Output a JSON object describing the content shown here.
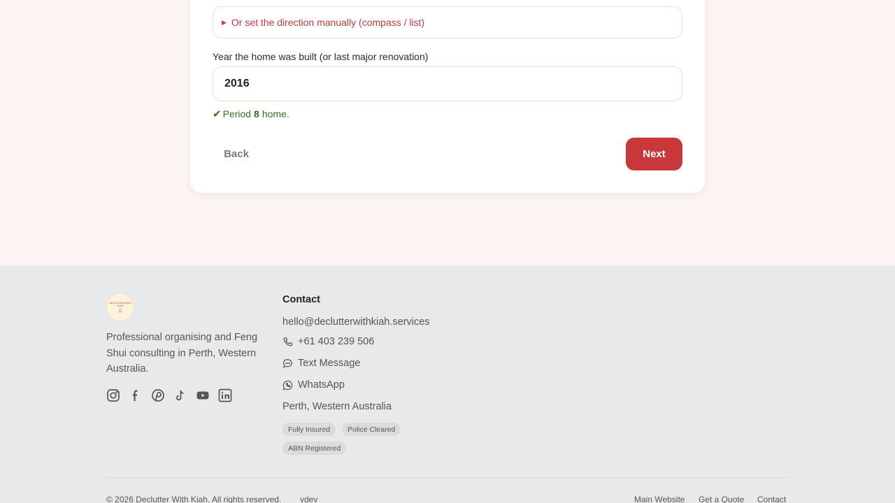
{
  "form": {
    "direction_toggle": "Or set the direction manually (compass / list)",
    "year_label": "Year the home was built (or last major renovation)",
    "year_value": "2016",
    "period_prefix": "Period",
    "period_number": "8",
    "period_suffix": "home.",
    "back_label": "Back",
    "next_label": "Next"
  },
  "footer": {
    "logo_text": "DECLUTTER WITH KIAH",
    "tagline": "Professional organising and Feng Shui consulting in Perth, Western Australia.",
    "contact_heading": "Contact",
    "email": "hello@declutterwithkiah.services",
    "phone": "+61 403 239 506",
    "text_message": "Text Message",
    "whatsapp": "WhatsApp",
    "location": "Perth, Western Australia",
    "badges": [
      "Fully Insured",
      "Police Cleared",
      "ABN Registered"
    ],
    "copyright": "© 2026 Declutter With Kiah. All rights reserved.",
    "credit": "vdev",
    "links": [
      "Main Website",
      "Get a Quote",
      "Contact"
    ],
    "socials": [
      "instagram-icon",
      "facebook-icon",
      "pinterest-icon",
      "tiktok-icon",
      "youtube-icon",
      "linkedin-icon"
    ]
  },
  "colors": {
    "accent": "#c8373a",
    "success": "#3b6b1f",
    "page_bg": "#fdf5f4",
    "footer_bg": "#e8e9eb"
  }
}
